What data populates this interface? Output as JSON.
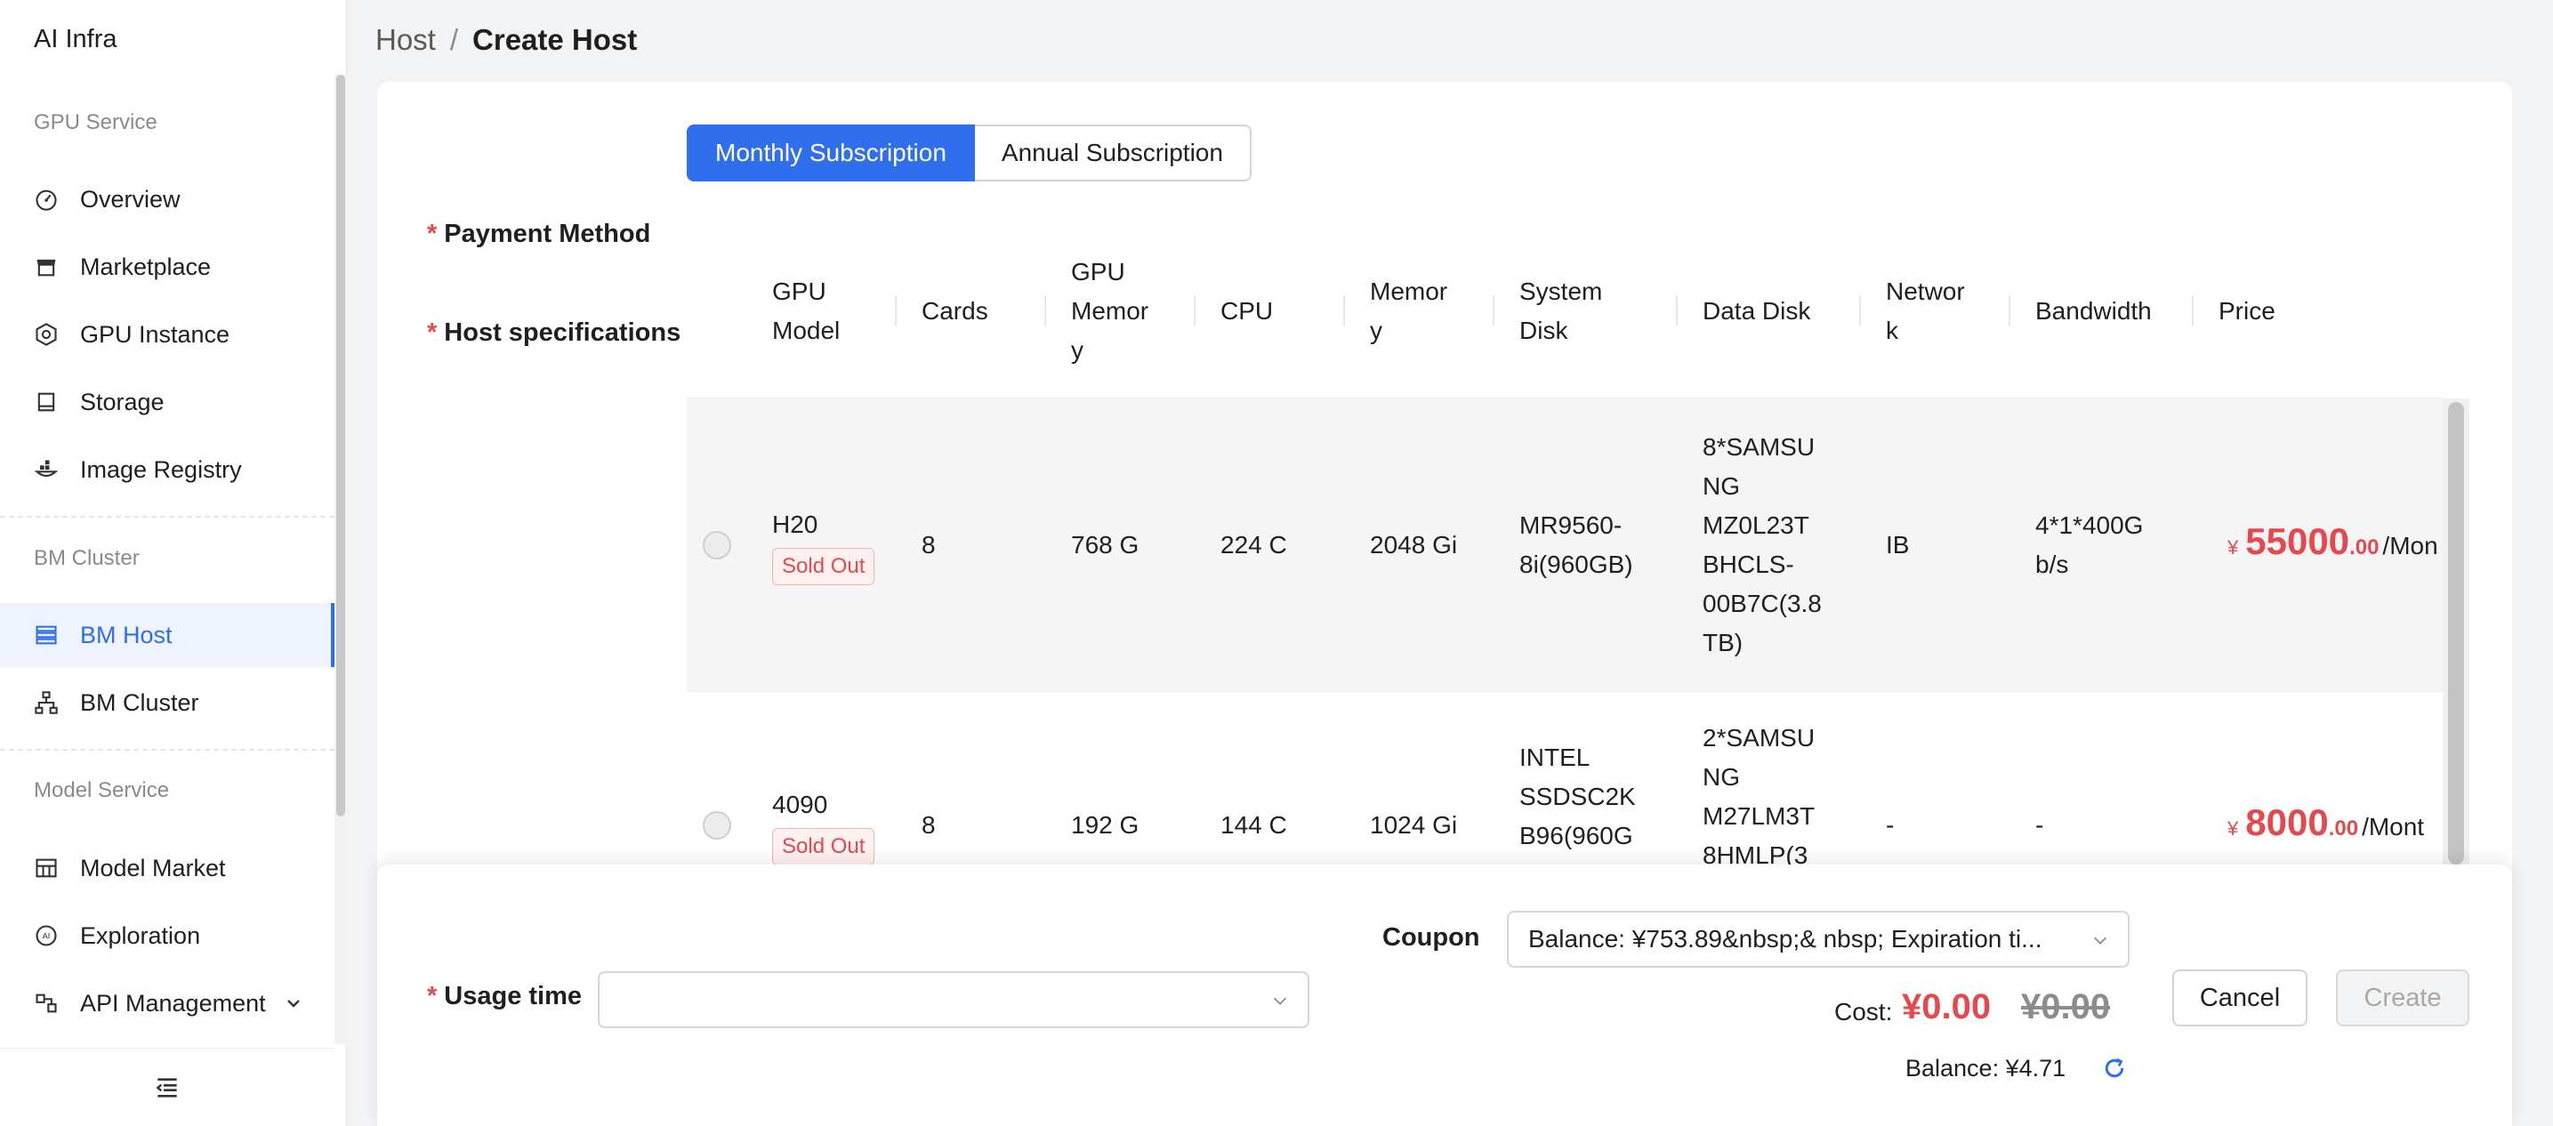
{
  "app": {
    "title": "AI Infra"
  },
  "sidebar": {
    "groups": [
      {
        "label": "GPU Service"
      },
      {
        "label": "BM Cluster"
      },
      {
        "label": "Model Service"
      }
    ],
    "items": [
      {
        "label": "Overview",
        "icon": "dashboard-icon"
      },
      {
        "label": "Marketplace",
        "icon": "store-icon"
      },
      {
        "label": "GPU Instance",
        "icon": "chip-icon"
      },
      {
        "label": "Storage",
        "icon": "storage-icon"
      },
      {
        "label": "Image Registry",
        "icon": "registry-icon"
      },
      {
        "label": "BM Host",
        "icon": "server-list-icon",
        "active": true
      },
      {
        "label": "BM Cluster",
        "icon": "cluster-icon"
      },
      {
        "label": "Model Market",
        "icon": "model-market-icon"
      },
      {
        "label": "Exploration",
        "icon": "ai-icon"
      },
      {
        "label": "API Management",
        "icon": "api-icon"
      }
    ],
    "collapse_icon": "collapse-menu-icon"
  },
  "breadcrumb": {
    "parent": "Host",
    "separator": "/",
    "current": "Create Host"
  },
  "form": {
    "payment_method": {
      "label": "Payment Method",
      "options": [
        "Monthly Subscription",
        "Annual Subscription"
      ],
      "selected": "Monthly Subscription"
    },
    "host_specs": {
      "label": "Host specifications",
      "columns": [
        "GPU\nModel",
        "Cards",
        "GPU\nMemor\ny",
        "CPU",
        "Memor\ny",
        "System\nDisk",
        "Data Disk",
        "Networ\nk",
        "Bandwidth",
        "Price"
      ],
      "rows": [
        {
          "gpu_model": "H20",
          "status": "Sold Out",
          "cards": "8",
          "gpu_memory": "768 G",
          "cpu": "224 C",
          "memory": "2048 Gi",
          "system_disk": "MR9560-\n8i(960GB)",
          "data_disk": "8*SAMSU\nNG\nMZ0L23T\nBHCLS-\n00B7C(3.8\nTB)",
          "network": "IB",
          "bandwidth": "4*1*400G\nb/s",
          "price_currency": "¥",
          "price_int": "55000",
          "price_dec": ".00",
          "price_unit": "/Mon"
        },
        {
          "gpu_model": "4090",
          "status": "Sold Out",
          "cards": "8",
          "gpu_memory": "192 G",
          "cpu": "144 C",
          "memory": "1024 Gi",
          "system_disk": "INTEL\nSSDSC2K\nB96(960G",
          "data_disk": "2*SAMSU\nNG\nM27LM3T\n8HMLP(3",
          "network": "-",
          "bandwidth": "-",
          "price_currency": "¥",
          "price_int": "8000",
          "price_dec": ".00",
          "price_unit": "/Mont"
        }
      ]
    },
    "usage_time": {
      "label": "Usage time",
      "value": "",
      "placeholder": ""
    },
    "coupon": {
      "label": "Coupon",
      "value": "Balance: ¥753.89&nbsp;& nbsp; Expiration ti..."
    },
    "cost": {
      "label": "Cost:",
      "value": "¥0.00",
      "original": "¥0.00"
    },
    "balance": {
      "text": "Balance: ¥4.71"
    },
    "buttons": {
      "cancel": "Cancel",
      "create": "Create"
    }
  },
  "colors": {
    "accent": "#2f6fed",
    "price": "#e5484d",
    "required": "#e5484d"
  }
}
